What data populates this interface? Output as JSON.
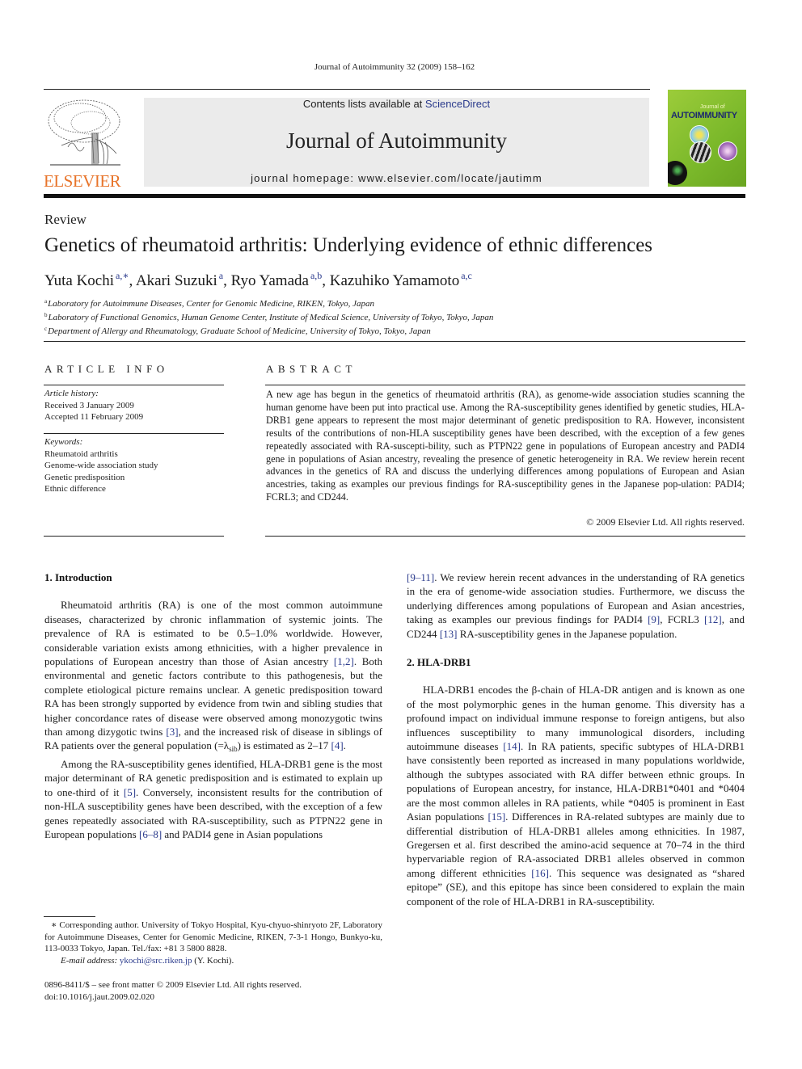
{
  "running_head": "Journal of Autoimmunity 32 (2009) 158–162",
  "masthead": {
    "publisher_logo_text": "ELSEVIER",
    "contents_prefix": "Contents lists available at ",
    "contents_link": "ScienceDirect",
    "journal_name": "Journal of Autoimmunity",
    "homepage": "journal homepage: www.elsevier.com/locate/jautimm",
    "cover": {
      "journal_of": "Journal of",
      "title": "AUTOIMMUNITY",
      "background_color": "#8cc232",
      "title_color": "#1d2a6e"
    },
    "logo_color": "#e8742a"
  },
  "article": {
    "type": "Review",
    "title": "Genetics of rheumatoid arthritis: Underlying evidence of ethnic differences",
    "authors": [
      {
        "name": "Yuta Kochi",
        "sup": "a,∗",
        "sep": ", "
      },
      {
        "name": "Akari Suzuki",
        "sup": "a",
        "sep": ", "
      },
      {
        "name": "Ryo Yamada",
        "sup": "a,b",
        "sep": ", "
      },
      {
        "name": "Kazuhiko Yamamoto",
        "sup": "a,c",
        "sep": ""
      }
    ],
    "affiliations": [
      {
        "key": "a",
        "text": "Laboratory for Autoimmune Diseases, Center for Genomic Medicine, RIKEN, Tokyo, Japan"
      },
      {
        "key": "b",
        "text": "Laboratory of Functional Genomics, Human Genome Center, Institute of Medical Science, University of Tokyo, Tokyo, Japan"
      },
      {
        "key": "c",
        "text": "Department of Allergy and Rheumatology, Graduate School of Medicine, University of Tokyo, Tokyo, Japan"
      }
    ]
  },
  "article_info": {
    "label": "ARTICLE INFO",
    "history_label": "Article history:",
    "received": "Received 3 January 2009",
    "accepted": "Accepted 11 February 2009",
    "keywords_label": "Keywords:",
    "keywords": [
      "Rheumatoid arthritis",
      "Genome-wide association study",
      "Genetic predisposition",
      "Ethnic difference"
    ]
  },
  "abstract": {
    "label": "ABSTRACT",
    "text": "A new age has begun in the genetics of rheumatoid arthritis (RA), as genome-wide association studies scanning the human genome have been put into practical use. Among the RA-susceptibility genes identified by genetic studies, HLA-DRB1 gene appears to represent the most major determinant of genetic predisposition to RA. However, inconsistent results of the contributions of non-HLA susceptibility genes have been described, with the exception of a few genes repeatedly associated with RA-suscepti-bility, such as PTPN22 gene in populations of European ancestry and PADI4 gene in populations of Asian ancestry, revealing the presence of genetic heterogeneity in RA. We review herein recent advances in the genetics of RA and discuss the underlying differences among populations of European and Asian ancestries, taking as examples our previous findings for RA-susceptibility genes in the Japanese pop-ulation: PADI4; FCRL3; and CD244.",
    "copyright": "© 2009 Elsevier Ltd. All rights reserved."
  },
  "body": {
    "intro_heading": "1.  Introduction",
    "intro_p1": [
      {
        "t": "Rheumatoid arthritis (RA) is one of the most common autoimmune diseases, characterized by chronic inflammation of systemic joints. The prevalence of RA is estimated to be 0.5–1.0% worldwide. However, considerable variation exists among ethnicities, with a higher prevalence in populations of European ancestry than those of Asian ancestry "
      },
      {
        "ref": "[1,2]"
      },
      {
        "t": ". Both environmental and genetic factors contribute to this pathogenesis, but the complete etiological picture remains unclear. A genetic predisposition toward RA has been strongly supported by evidence from twin and sibling studies that higher concordance rates of disease were observed among monozygotic twins than among dizygotic twins "
      },
      {
        "ref": "[3]"
      },
      {
        "t": ", and the increased risk of disease in siblings of RA patients over the general population (=λ"
      },
      {
        "sub": "sib"
      },
      {
        "t": ") is estimated as 2–17 "
      },
      {
        "ref": "[4]"
      },
      {
        "t": "."
      }
    ],
    "intro_p2": [
      {
        "t": "Among the RA-susceptibility genes identified, HLA-DRB1 gene is the most major determinant of RA genetic predisposition and is estimated to explain up to one-third of it "
      },
      {
        "ref": "[5]"
      },
      {
        "t": ". Conversely, inconsistent results for the contribution of non-HLA susceptibility genes have been described, with the exception of a few genes repeatedly associated with RA-susceptibility, such as PTPN22 gene in European populations "
      },
      {
        "ref": "[6–8]"
      },
      {
        "t": " and PADI4 gene in Asian populations "
      }
    ],
    "intro_p2_cont": [
      {
        "ref": "[9–11]"
      },
      {
        "t": ". We review herein recent advances in the understanding of RA genetics in the era of genome-wide association studies. Furthermore, we discuss the underlying differences among populations of European and Asian ancestries, taking as examples our previous findings for PADI4 "
      },
      {
        "ref": "[9]"
      },
      {
        "t": ", FCRL3 "
      },
      {
        "ref": "[12]"
      },
      {
        "t": ", and CD244 "
      },
      {
        "ref": "[13]"
      },
      {
        "t": " RA-susceptibility genes in the Japanese population."
      }
    ],
    "hla_heading": "2.  HLA-DRB1",
    "hla_p1": [
      {
        "t": "HLA-DRB1 encodes the β-chain of HLA-DR antigen and is known as one of the most polymorphic genes in the human genome. This diversity has a profound impact on individual immune response to foreign antigens, but also influences susceptibility to many immunological disorders, including autoimmune diseases "
      },
      {
        "ref": "[14]"
      },
      {
        "t": ". In RA patients, specific subtypes of HLA-DRB1 have consistently been reported as increased in many populations worldwide, although the subtypes associated with RA differ between ethnic groups. In populations of European ancestry, for instance, HLA-DRB1*0401 and *0404 are the most common alleles in RA patients, while *0405 is prominent in East Asian populations "
      },
      {
        "ref": "[15]"
      },
      {
        "t": ". Differences in RA-related subtypes are mainly due to differential distribution of HLA-DRB1 alleles among ethnicities. In 1987, Gregersen et al. first described the amino-acid sequence at 70–74 in the third hypervariable region of RA-associated DRB1 alleles observed in common among different ethnicities "
      },
      {
        "ref": "[16]"
      },
      {
        "t": ". This sequence was designated as “shared epitope” (SE), and this epitope has since been considered to explain the main component of the role of HLA-DRB1 in RA-susceptibility."
      }
    ]
  },
  "footnote": {
    "corresponding": "∗ Corresponding author. University of Tokyo Hospital, Kyu-chyuo-shinryoto 2F, Laboratory for Autoimmune Diseases, Center for Genomic Medicine, RIKEN, 7-3-1 Hongo, Bunkyo-ku, 113-0033 Tokyo, Japan. Tel./fax: +81 3 5800 8828.",
    "email_label": "E-mail address: ",
    "email": "ykochi@src.riken.jp",
    "email_suffix": " (Y. Kochi).",
    "front_matter": "0896-8411/$ – see front matter © 2009 Elsevier Ltd. All rights reserved.",
    "doi": "doi:10.1016/j.jaut.2009.02.020"
  }
}
